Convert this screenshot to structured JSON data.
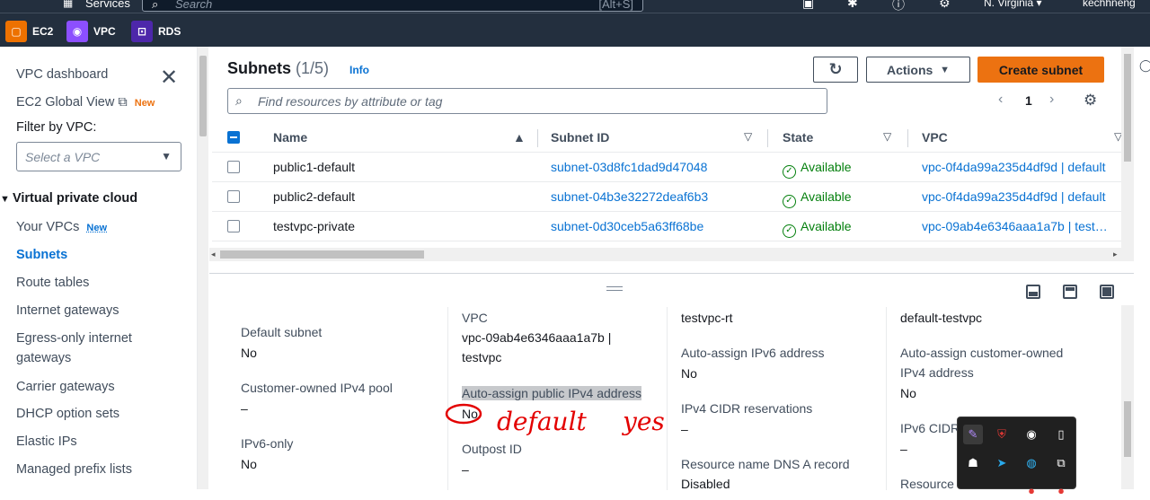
{
  "topnav": {
    "services_label": "Services",
    "search_placeholder": "Search",
    "search_shortcut": "[Alt+S]",
    "region": "N. Virginia ▾",
    "user": "kechhneng"
  },
  "favorites": [
    {
      "label": "EC2",
      "color": "#ed7100",
      "icon": "ec2-icon"
    },
    {
      "label": "VPC",
      "color": "#8c4fff",
      "icon": "vpc-icon"
    },
    {
      "label": "RDS",
      "color": "#4d27aa",
      "icon": "rds-icon"
    }
  ],
  "sidebar": {
    "dashboard": "VPC dashboard",
    "ec2_global_view": "EC2 Global View",
    "new_badge": "New",
    "filter_label": "Filter by VPC:",
    "filter_placeholder": "Select a VPC",
    "section": "Virtual private cloud",
    "items": [
      {
        "label": "Your VPCs",
        "badge": "New"
      },
      {
        "label": "Subnets",
        "active": true
      },
      {
        "label": "Route tables"
      },
      {
        "label": "Internet gateways"
      },
      {
        "label": "Egress-only internet"
      },
      {
        "label": "gateways"
      },
      {
        "label": "Carrier gateways"
      },
      {
        "label": "DHCP option sets"
      },
      {
        "label": "Elastic IPs"
      },
      {
        "label": "Managed prefix lists"
      }
    ]
  },
  "main": {
    "title": "Subnets",
    "count": "(1/5)",
    "info": "Info",
    "actions_label": "Actions",
    "create_label": "Create subnet",
    "search_placeholder": "Find resources by attribute or tag",
    "page_number": "1",
    "columns": [
      "Name",
      "Subnet ID",
      "State",
      "VPC"
    ],
    "rows": [
      {
        "name": "public1-default",
        "subnet_id": "subnet-03d8fc1dad9d47048",
        "state": "Available",
        "vpc": "vpc-0f4da99a235d4df9d | default"
      },
      {
        "name": "public2-default",
        "subnet_id": "subnet-04b3e32272deaf6b3",
        "state": "Available",
        "vpc": "vpc-0f4da99a235d4df9d | default"
      },
      {
        "name": "testvpc-private",
        "subnet_id": "subnet-0d30ceb5a63ff68be",
        "state": "Available",
        "vpc": "vpc-09ab4e6346aaa1a7b | test…"
      }
    ]
  },
  "details": {
    "col1": [
      {
        "label": "Default subnet",
        "value": "No"
      },
      {
        "label": "Customer-owned IPv4 pool",
        "value": "–"
      },
      {
        "label": "IPv6-only",
        "value": "No"
      }
    ],
    "col2": {
      "vpc_label": "VPC",
      "vpc_value_line1": "vpc-09ab4e6346aaa1a7b |",
      "vpc_value_line2": "testvpc",
      "autoassign_label": "Auto-assign public IPv4 address",
      "autoassign_value": "No",
      "outpost_label": "Outpost ID",
      "outpost_value": "–"
    },
    "col3": {
      "route_table": "testvpc-rt",
      "ipv6_label": "Auto-assign IPv6 address",
      "ipv6_value": "No",
      "cidr_res_label": "IPv4 CIDR reservations",
      "cidr_res_value": "–",
      "dns_label": "Resource name DNS A record",
      "dns_value": "Disabled"
    },
    "col4": {
      "nacl": "default-testvpc",
      "coip_label_line1": "Auto-assign customer-owned",
      "coip_label_line2": "IPv4 address",
      "coip_value": "No",
      "ipv6cidr_label": "IPv6 CIDR",
      "ipv6cidr_value": "–",
      "resource_label": "Resource"
    }
  },
  "annotation": {
    "note1": "default",
    "note2": "yes"
  }
}
